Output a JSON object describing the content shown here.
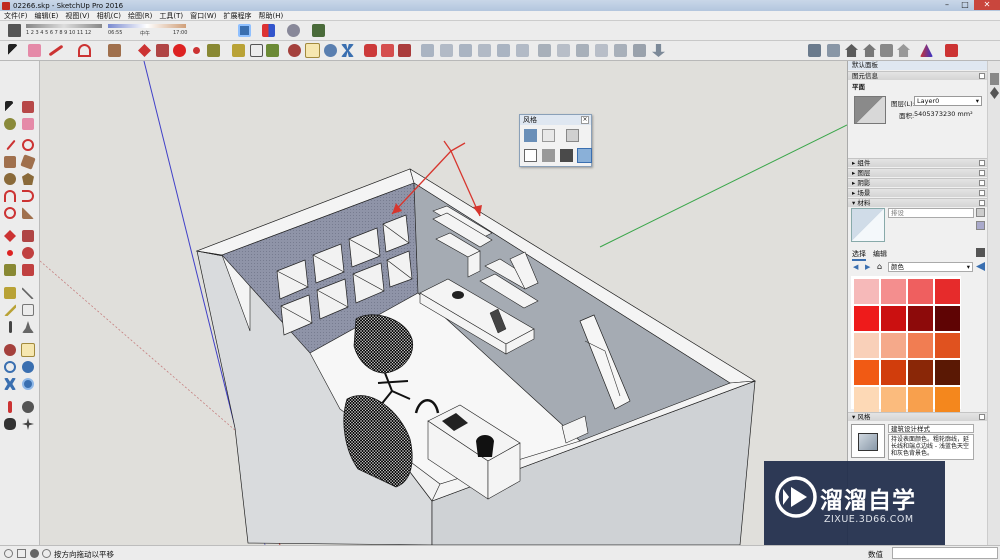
{
  "window": {
    "title": "02266.skp - SketchUp Pro 2016",
    "minimize": "–",
    "maximize": "□",
    "close": "✕"
  },
  "menu": [
    "文件(F)",
    "编辑(E)",
    "视图(V)",
    "相机(C)",
    "绘图(R)",
    "工具(T)",
    "窗口(W)",
    "扩展程序",
    "帮助(H)"
  ],
  "shadow_slider": {
    "hours": "1 2 3 4 5 6 7 8 9 10 11 12",
    "time_start": "06:55",
    "time_mid": "中午",
    "time_end": "17:00"
  },
  "styles_dialog": {
    "title": "风格"
  },
  "right_panel": {
    "default_tray": "默认面板",
    "entity_info": {
      "header": "图元信息",
      "type": "平面",
      "layer_label": "图层(L):",
      "layer_value": "Layer0",
      "area_label": "面积:",
      "area_value": "5405373230 mm²"
    },
    "collapsed": [
      "组件",
      "图层",
      "阴影",
      "场景"
    ],
    "materials": {
      "header": "材料",
      "name_placeholder": "排设",
      "tab_select": "选择",
      "tab_edit": "编辑",
      "library": "颜色"
    },
    "styles": {
      "header": "风格",
      "style_name": "建筑设计样式",
      "style_desc": "持设表面颜色。粗轮廓线，延长线和端点边线 - 浅蓝色天空和灰色背景色。"
    }
  },
  "swatch_colors": [
    "#f6b9b9",
    "#f48e8e",
    "#ef5f5f",
    "#e62b2b",
    "#ee1b1b",
    "#cb1010",
    "#8d0a0a",
    "#5f0404",
    "#f9d0b9",
    "#f5a98a",
    "#f17d52",
    "#e0521f",
    "#f15a14",
    "#d13d0c",
    "#8a2707",
    "#5a1804",
    "#fdd9b6",
    "#fbbb7d",
    "#f8a04d",
    "#f4871d"
  ],
  "status": {
    "hint": "按方向拖动以平移",
    "measurements_label": "数值"
  },
  "watermark": {
    "brand": "溜溜自学",
    "url": "ZIXUE.3D66.COM"
  },
  "colors": {
    "accent": "#3a6fb0",
    "axis_red": "#c64040",
    "axis_green": "#3aa64a",
    "axis_blue": "#4040c8",
    "back_wall": "#8f94a8",
    "side_wall": "#a5abb3",
    "arrow": "#d7362e"
  }
}
